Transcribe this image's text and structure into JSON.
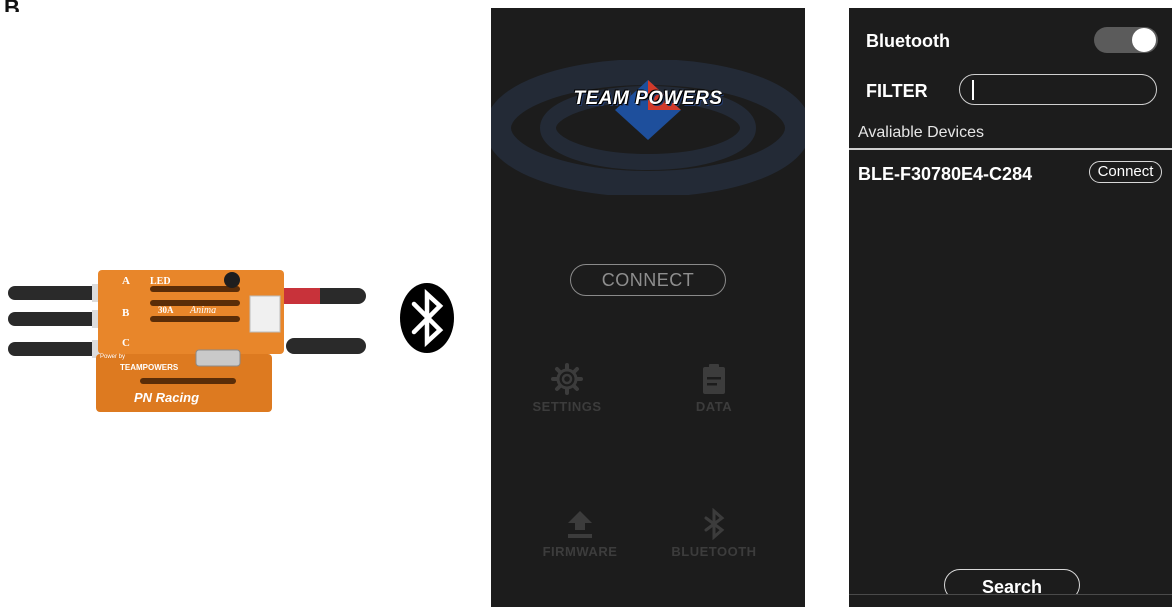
{
  "figure_label": "B",
  "colors": {
    "phone_background": "#1c1c1c",
    "connect_outline": "#8a8a8a",
    "tile_text": "#3c3c3c",
    "device_body": "#e8862a",
    "toggle_track": "#5b5b5b",
    "logo_blue": "#1e4f9c",
    "logo_red": "#d23a2a"
  },
  "device_photo": {
    "labels": {
      "led": "LED",
      "a": "A",
      "b": "B",
      "c": "C",
      "rating": "30A",
      "brand_script": "Anima",
      "powered_by": "Power by",
      "maker": "TEAMPOWERS",
      "racing": "PN Racing"
    }
  },
  "home_screen": {
    "logo_text": "TEAM POWERS",
    "connect_label": "CONNECT",
    "tiles": [
      {
        "label": "SETTINGS",
        "icon": "gear-icon"
      },
      {
        "label": "DATA",
        "icon": "clipboard-icon"
      },
      {
        "label": "FIRMWARE",
        "icon": "upload-icon"
      },
      {
        "label": "BLUETOOTH",
        "icon": "bluetooth-icon"
      }
    ]
  },
  "bluetooth_screen": {
    "title": "Bluetooth",
    "toggle_on": true,
    "filter_label": "FILTER",
    "filter_value": "",
    "available_label": "Avaliable Devices",
    "devices": [
      {
        "name": "BLE-F30780E4-C284",
        "action": "Connect"
      }
    ],
    "search_label": "Search"
  }
}
